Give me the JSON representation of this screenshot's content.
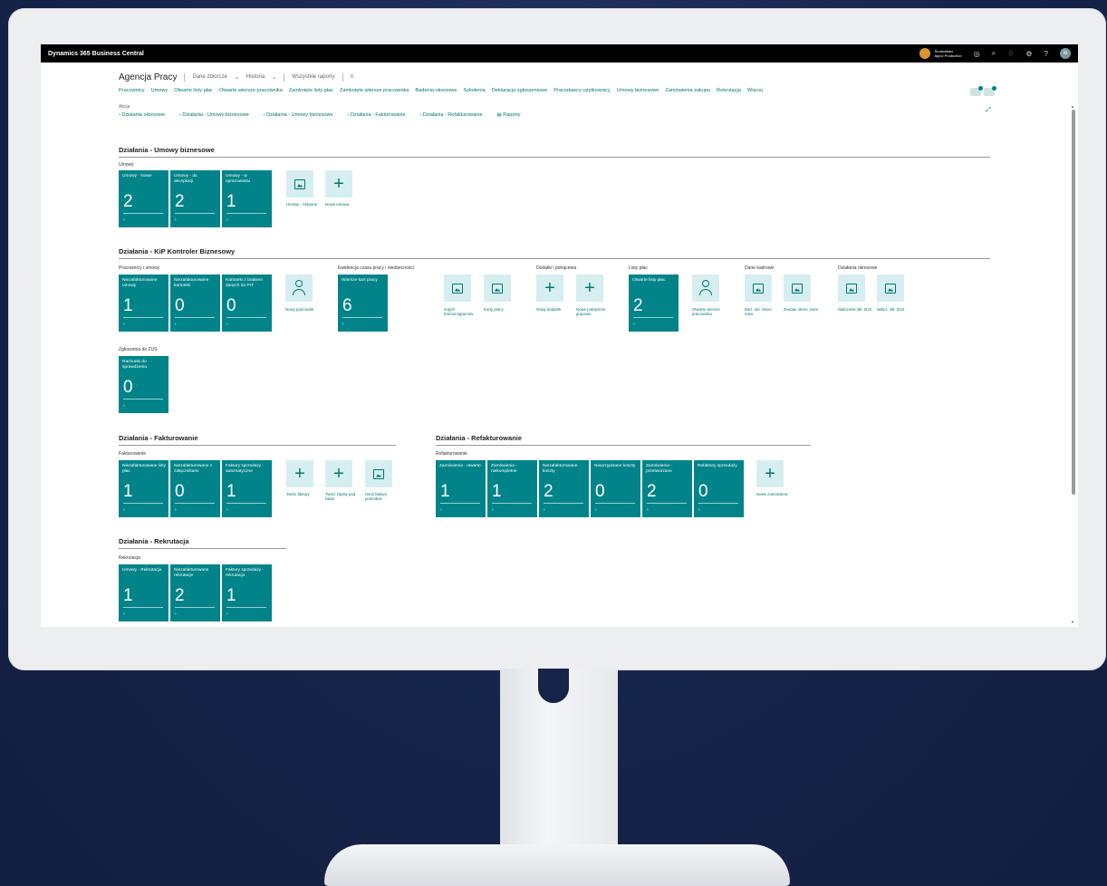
{
  "app": {
    "brand": "Dynamics 365 Business Central",
    "company_line1": "Środowisko",
    "company_line2": "AppU Production",
    "user_initial": "M"
  },
  "header": {
    "title": "Agencja Pracy",
    "menus": [
      "Dane zbiorcze",
      "Historia",
      "Wszystkie raporty",
      "≡"
    ]
  },
  "nav": [
    "Pracownicy",
    "Umowy",
    "Otwarte listy płac",
    "Otwarte wiersze pracownika",
    "Zamknięte listy płac",
    "Zamknięte wiersze pracownika",
    "Badania okresowe",
    "Szkolenia",
    "Deklaracja zgłoszeniowe",
    "Pracodawcy-użytkownicy",
    "Umowy biznesowe",
    "Zamówienia zakupu",
    "Rekrutacja",
    "Więcej"
  ],
  "actions_label": "Akcja",
  "actions": [
    "› Działania okresowe",
    "› Działania - Umowy biznesowe",
    "› Działania - Umowy biznesowe",
    "› Działania - Fakturowanie",
    "› Działania - Refakturowanie",
    "▤ Raporty"
  ],
  "sections": {
    "umowy_biz": {
      "title": "Działania - Umowy biznesowe",
      "group": "Umowy",
      "tiles": [
        {
          "label": "Umowy - Nowe",
          "value": "2"
        },
        {
          "label": "Umowy - do akceptacji",
          "value": "2"
        },
        {
          "label": "Umowy - w opracowaniu",
          "value": "1"
        }
      ],
      "acts": [
        "Umowy - Aktywne",
        "Nowa umowa"
      ]
    },
    "kip": {
      "title": "Działania - KiP Kontroler Biznesowy",
      "groups": [
        "Pracownicy i umowy",
        "Ewidencja czasu pracy i nieobecności",
        "Dodatki i potrącenia",
        "Listy płac",
        "Dane kadrowe",
        "Działania okresowe",
        "Zgłoszenia do ZUS"
      ],
      "tiles": [
        {
          "label": "Niezafakturowane umowy",
          "value": "1"
        },
        {
          "label": "Niezafakturowane kartoteki",
          "value": "0"
        },
        {
          "label": "Kartoteki z brakiem danych do PIT",
          "value": "0"
        },
        {
          "label": "Wiersze kart pracy",
          "value": "6"
        },
        {
          "label": "Otwarte listy płac",
          "value": "2"
        },
        {
          "label": "Rachunki do sprawdzenia",
          "value": "0"
        }
      ],
      "acts": [
        "Nowy pracownik",
        "Import harmonogramów",
        "Karty pracy",
        "Nowy dodatek",
        "Nowe potrącenie grupowe",
        "Otwarte wiersze pracownika",
        "Bież. obr. okres. mies.",
        "Zestaw. okres. mies.",
        "Naliczenie skł. ZUS",
        "Nalicz. skł. ZUS"
      ]
    },
    "fakt": {
      "title": "Działania - Fakturowanie",
      "group": "Fakturowanie",
      "tiles": [
        {
          "label": "Niezafakturowane listy płac",
          "value": "1"
        },
        {
          "label": "Niezafakturowane z załącznikami",
          "value": "0"
        },
        {
          "label": "Faktury sprzedaży - automatyczne",
          "value": "1"
        }
      ],
      "acts": [
        "Twórz faktury",
        "Twórz zapisy pod faktur",
        "Usuń faktury pośrednie"
      ]
    },
    "refakt": {
      "title": "Działania - Refakturowanie",
      "group": "Refakturowanie",
      "tiles": [
        {
          "label": "Zamówienia - otwarte",
          "value": "1"
        },
        {
          "label": "Zamówienia - niekompletne",
          "value": "1"
        },
        {
          "label": "Niezafakturowane koszty",
          "value": "2"
        },
        {
          "label": "Nieprzypisane koszty",
          "value": "0"
        },
        {
          "label": "Zamówienia - przetwarzane",
          "value": "2"
        },
        {
          "label": "Refaktury sprzedaży",
          "value": "0"
        }
      ],
      "acts": [
        "Nowe zamówienie"
      ]
    },
    "rekr": {
      "title": "Działania - Rekrutacja",
      "group": "Rekrutacja",
      "tiles": [
        {
          "label": "Umowy - Rekrutacja",
          "value": "1"
        },
        {
          "label": "Niezafakturowane rekrutacje",
          "value": "2"
        },
        {
          "label": "Faktury sprzedaży - rekrutacja",
          "value": "1"
        }
      ]
    }
  },
  "colors": {
    "accent": "#008489",
    "link": "#00776e",
    "background": "#16244a"
  }
}
